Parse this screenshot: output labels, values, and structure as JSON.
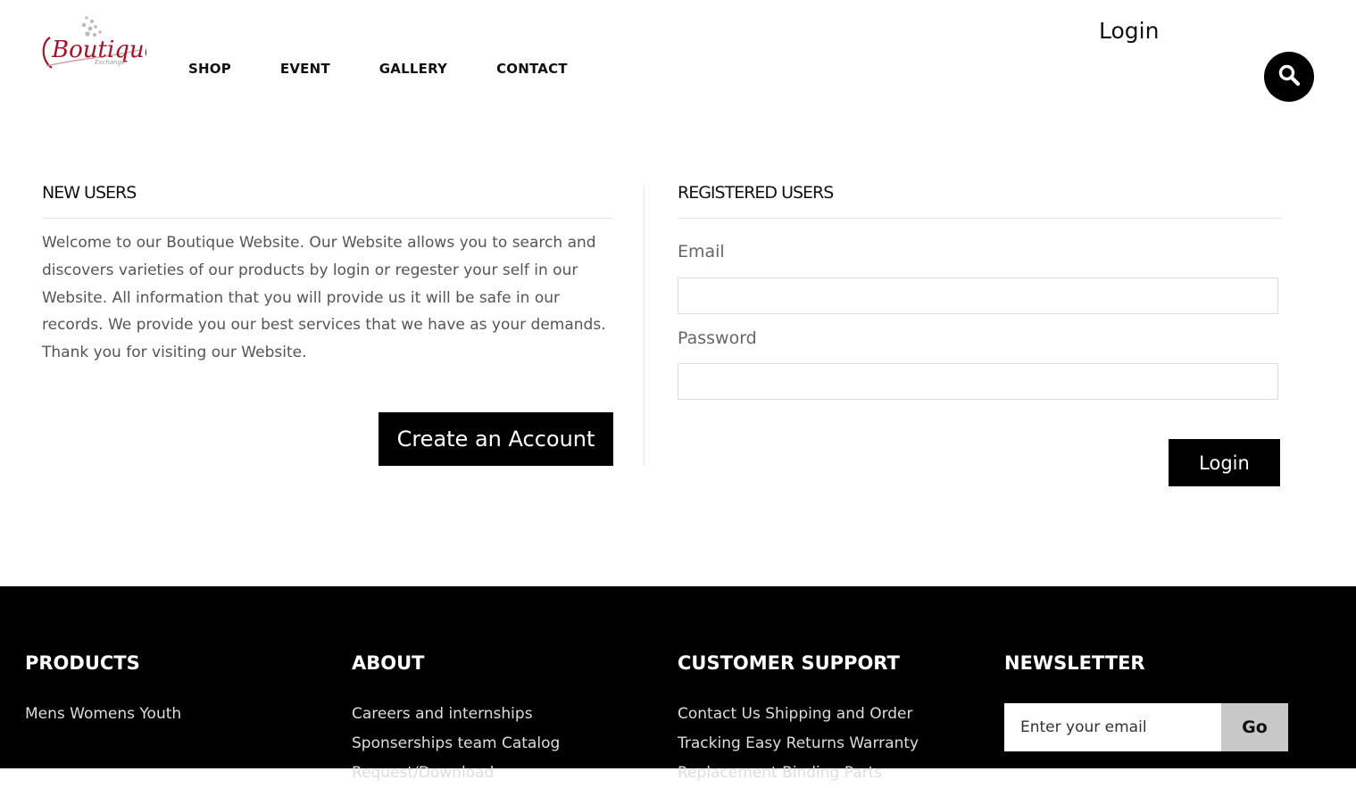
{
  "header": {
    "logo_text": "Boutique",
    "logo_subtext": "Exchange",
    "nav": [
      "SHOP",
      "EVENT",
      "GALLERY",
      "CONTACT"
    ],
    "login_link": "Login",
    "search_icon": "search-icon"
  },
  "new_users": {
    "title": "NEW USERS",
    "welcome_text": "Welcome to our Boutique Website. Our Website allows you to search and discovers varieties of our products by login or regester your self in our Website. All information that you will provide us it will be safe in our records. We provide you our best services that we have as your demands. Thank you for visiting our Website.",
    "create_button": "Create an Account"
  },
  "registered_users": {
    "title": "REGISTERED USERS",
    "email_label": "Email",
    "email_value": "",
    "password_label": "Password",
    "password_value": "",
    "login_button": "Login"
  },
  "footer": {
    "products": {
      "title": "PRODUCTS",
      "text": "Mens Womens Youth"
    },
    "about": {
      "title": "ABOUT",
      "text": "Careers and internships Sponserships team Catalog Request/Download"
    },
    "support": {
      "title": "CUSTOMER SUPPORT",
      "text": "Contact Us Shipping and Order Tracking Easy Returns Warranty Replacement Binding Parts"
    },
    "newsletter": {
      "title": "NEWSLETTER",
      "placeholder": "Enter your email",
      "button": "Go"
    }
  },
  "colors": {
    "accent": "#000000",
    "logo_red": "#a0152a",
    "footer_bg": "#000000"
  }
}
